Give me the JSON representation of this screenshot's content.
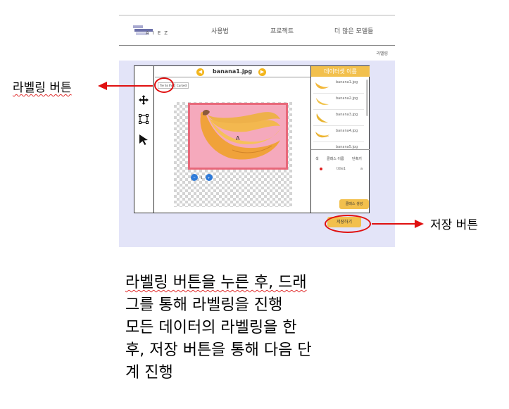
{
  "header": {
    "logo_text": "AIEZ",
    "nav": [
      "사용법",
      "프로젝트",
      "더 많은 모델들"
    ],
    "breadcrumb": "라벨링"
  },
  "editor": {
    "file_name": "banana1.jpg",
    "mode_buttons": [
      "Tie Ss Ihrit",
      "Cursed"
    ],
    "box_label": "A",
    "zoom_value": "1"
  },
  "dataset_panel": {
    "title": "데이터셋 이름",
    "files": [
      "banana1.jpg",
      "banana2.jpg",
      "banana3.jpg",
      "banana4.jpg",
      "banana5.jpg"
    ]
  },
  "class_table": {
    "headers": [
      "색",
      "클래스 이름",
      "단축키"
    ],
    "rows": [
      {
        "name": "title1",
        "key": "a"
      }
    ],
    "create_button": "클래스 생성"
  },
  "save_button": "저장하기",
  "annotations": {
    "labeling_button": "라벨링 버튼",
    "save_button": "저장 버튼",
    "description": [
      "라벨링 버튼을 누른 후, 드래",
      "그를 통해 라벨링을 진행",
      "모든 데이터의 라벨링을 한",
      "후, 저장 버튼을 통해 다음 단",
      "계 진행"
    ]
  },
  "colors": {
    "accent_yellow": "#f2c04d",
    "annotation_red": "#e01010",
    "workarea_bg": "#e3e4f8",
    "bbox_pink": "#f5a9bc"
  }
}
